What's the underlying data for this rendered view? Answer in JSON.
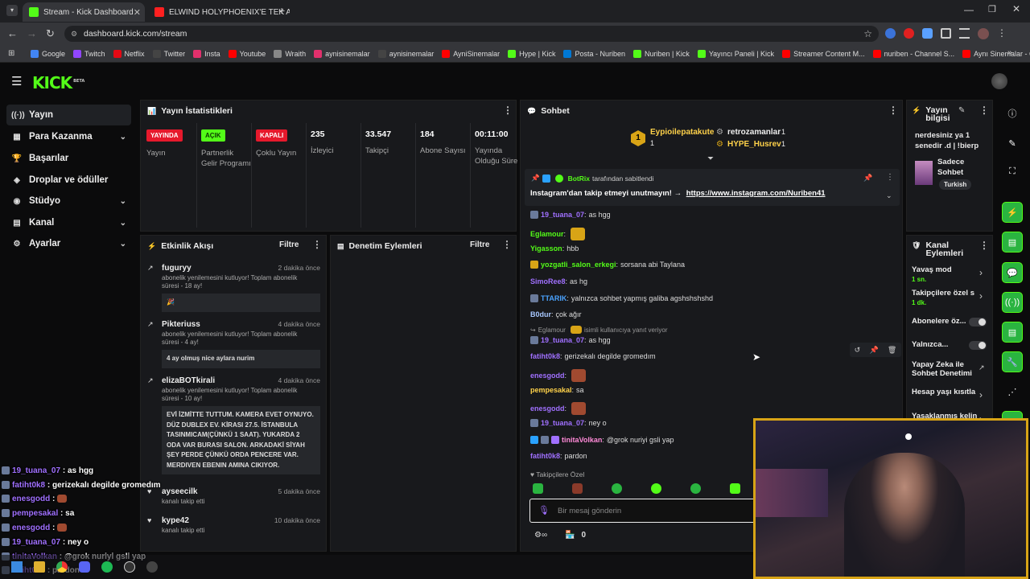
{
  "browser": {
    "tabs": [
      {
        "title": "Stream - Kick Dashboard",
        "color": "#53fc18"
      },
      {
        "title": "ELWIND HOLYPHOENIX'E TEK A",
        "color": "#ff2020"
      }
    ],
    "url": "dashboard.kick.com/stream",
    "bookmarks": [
      {
        "label": "Google",
        "color": "#4285f4"
      },
      {
        "label": "Twitch",
        "color": "#9146ff"
      },
      {
        "label": "Netflix",
        "color": "#e50914"
      },
      {
        "label": "Twitter",
        "color": "#444444"
      },
      {
        "label": "Insta",
        "color": "#e1306c"
      },
      {
        "label": "Youtube",
        "color": "#ff0000"
      },
      {
        "label": "Wraith",
        "color": "#888888"
      },
      {
        "label": "aynisinemalar",
        "color": "#e1306c"
      },
      {
        "label": "aynisinemalar",
        "color": "#444444"
      },
      {
        "label": "AyniSinemalar",
        "color": "#ff0000"
      },
      {
        "label": "Hype | Kick",
        "color": "#53fc18"
      },
      {
        "label": "Posta - Nuriben",
        "color": "#0078d4"
      },
      {
        "label": "Nuriben | Kick",
        "color": "#53fc18"
      },
      {
        "label": "Yayıncı Paneli | Kick",
        "color": "#53fc18"
      },
      {
        "label": "Streamer Content M...",
        "color": "#ff0000"
      },
      {
        "label": "nuriben - Channel S...",
        "color": "#ff0000"
      },
      {
        "label": "Aynı Sinemalar - Ça...",
        "color": "#ff0000"
      }
    ]
  },
  "kick": {
    "logo": "KICK",
    "logo_sup": "BETA"
  },
  "sidebar": {
    "items": [
      {
        "label": "Yayın",
        "icon": "((·))"
      },
      {
        "label": "Para Kazanma",
        "icon": "▦"
      },
      {
        "label": "Başarılar",
        "icon": "🏆"
      },
      {
        "label": "Droplar ve ödüller",
        "icon": "◈"
      },
      {
        "label": "Stüdyo",
        "icon": "◉"
      },
      {
        "label": "Kanal",
        "icon": "▤"
      },
      {
        "label": "Ayarlar",
        "icon": "⚙"
      }
    ]
  },
  "stats": {
    "title": "Yayın İstatistikleri",
    "cols": [
      {
        "value": "YAYINDA",
        "label": "Yayın",
        "badge_color": "#e6192c"
      },
      {
        "value": "AÇIK",
        "label": "Partnerlik Gelir Programı",
        "badge_color": "#53fc18"
      },
      {
        "value": "KAPALI",
        "label": "Çoklu Yayın",
        "badge_color": "#e6192c"
      },
      {
        "value": "235",
        "label": "İzleyici"
      },
      {
        "value": "33.547",
        "label": "Takipçi"
      },
      {
        "value": "184",
        "label": "Abone Sayısı"
      },
      {
        "value": "00:11:00",
        "label": "Yayında Olduğu Süre"
      }
    ]
  },
  "activity": {
    "title": "Etkinlik Akışı",
    "filter": "Filtre",
    "events": [
      {
        "user": "fuguryy",
        "time": "2 dakika önce",
        "desc": "abonelik yenilemesini kutluyor! Toplam abonelik süresi - 18 ay!",
        "message": "🎉"
      },
      {
        "user": "Pikteriuss",
        "time": "4 dakika önce",
        "desc": "abonelik yenilemesini kutluyor! Toplam abonelik süresi - 4 ay!",
        "message": "4 ay olmuş nice aylara nurim"
      },
      {
        "user": "elizaBOTkirali",
        "time": "4 dakika önce",
        "desc": "abonelik yenilemesini kutluyor! Toplam abonelik süresi - 10 ay!",
        "message": "EVİ İZMİTTE TUTTUM. KAMERA EVET OYNUYO. DÜZ DUBLEX EV. KİRASI 27.5. İSTANBULA TASINMICAM(ÇÜNKÜ 1 SAAT). YUKARDA 2 ODA VAR BURASI SALON. ARKADAKİ SİYAH ŞEY PERDE ÇÜNKÜ ORDA PENCERE VAR. MERDIVEN EBENIN AMINA CIKIYOR."
      },
      {
        "user": "ayseecilk",
        "time": "5 dakika önce",
        "desc": "kanalı takip etti"
      },
      {
        "user": "kype42",
        "time": "10 dakika önce",
        "desc": "kanalı takip etti"
      }
    ]
  },
  "moderation": {
    "title": "Denetim Eylemleri",
    "filter": "Filtre"
  },
  "chat": {
    "title": "Sohbet",
    "top_gifters": [
      {
        "name": "Eypioilepatakute",
        "count": "1"
      },
      {
        "name": "retrozamanlar",
        "count": "1"
      },
      {
        "name": "HYPE_Husrev",
        "count": "1"
      }
    ],
    "rank": "1",
    "pinned": {
      "by": "BotRix",
      "suffix": "tarafından sabitlendi",
      "text": "Instagram'dan takip etmeyi unutmayın! →",
      "link": "https://www.instagram.com/Nuriben41"
    },
    "messages": [
      {
        "user": "19_tuana_07",
        "color": "#a070ff",
        "text": "as hgg"
      },
      {
        "user": "Eglamour",
        "color": "#53fc18",
        "text": ""
      },
      {
        "user": "Yigasson",
        "color": "#53fc18",
        "text": "hbb"
      },
      {
        "user": "yozgatli_salon_erkegi",
        "color": "#53fc18",
        "text": "sorsana abi Taylana"
      },
      {
        "user": "SimoRee8",
        "color": "#a070ff",
        "text": "as hg"
      },
      {
        "user": "TTARIK",
        "color": "#4aa3ff",
        "text": "yalnızca sohbet yapmış galiba agshshshshd"
      },
      {
        "user": "B0dur",
        "color": "#a8c8ff",
        "text": "çok ağır"
      },
      {
        "user": "19_tuana_07",
        "color": "#a070ff",
        "text": "as hgg"
      },
      {
        "user": "fatiht0k8",
        "color": "#a070ff",
        "text": "gerizekalı degilde gromedım"
      },
      {
        "user": "enesgodd",
        "color": "#a070ff",
        "text": ""
      },
      {
        "user": "pempesakal",
        "color": "#ffd24a",
        "text": "sa"
      },
      {
        "user": "enesgodd",
        "color": "#a070ff",
        "text": ""
      },
      {
        "user": "19_tuana_07",
        "color": "#a070ff",
        "text": "ney o"
      },
      {
        "user": "tinitaVolkan",
        "color": "#ff8ad8",
        "text": "@grok nuriyi gsli yap"
      },
      {
        "user": "fatiht0k8",
        "color": "#a070ff",
        "text": "pardon"
      }
    ],
    "reply_hint_user": "Eglamour",
    "reply_hint_text": "isimli kullanıcıya yanıt veriyor",
    "followers_only": "Takipçilere Özel",
    "input_placeholder": "Bir mesaj gönderin",
    "points": "0"
  },
  "stream_info": {
    "title": "Yayın bilgisi",
    "desc": "nerdesiniz ya 1 senedir .d | !bierp",
    "category": "Sadece Sohbet",
    "tag": "Turkish"
  },
  "channel_actions": {
    "title": "Kanal Eylemleri",
    "items": [
      {
        "label": "Yavaş mod",
        "sub": "1 sn."
      },
      {
        "label": "Takipçilere özel s",
        "sub": "1 dk."
      },
      {
        "label": "Abonelere öz...",
        "sub": ""
      },
      {
        "label": "Yalnızca...",
        "sub": ""
      },
      {
        "label": "Yapay Zeka ile Sohbet Denetimi",
        "sub": ""
      },
      {
        "label": "Hesap yaşı kısıtla",
        "sub": ""
      },
      {
        "label": "Yasaklanmış kelin",
        "sub": ""
      }
    ]
  },
  "overlay_chat": [
    {
      "user": "19_tuana_07",
      "text": "as hgg"
    },
    {
      "user": "fatiht0k8",
      "text": "gerizekalı degilde gromedım"
    },
    {
      "user": "enesgodd",
      "text": ""
    },
    {
      "user": "pempesakal",
      "text": "sa"
    },
    {
      "user": "enesgodd",
      "text": ""
    },
    {
      "user": "19_tuana_07",
      "text": "ney o"
    },
    {
      "user": "tinitaVolkan",
      "text": "@grok nuriyi gsli yap"
    },
    {
      "user": "fatiht0k8",
      "text": "pardon"
    }
  ],
  "colors": {
    "kick_green": "#53fc18",
    "live_red": "#e6192c",
    "cam_border": "#d8a416"
  }
}
